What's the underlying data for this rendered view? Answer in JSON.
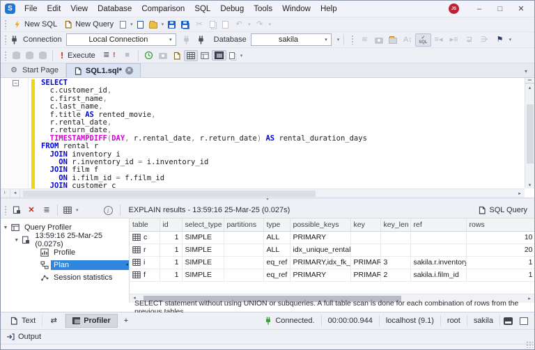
{
  "icons": {
    "caret_down": "▾",
    "caret_up": "▴",
    "arrow_left": "◂",
    "arrow_right": "▸",
    "close": "✕",
    "minimize": "–",
    "maximize": "□",
    "stop": "■",
    "undo": "↶",
    "redo": "↷",
    "history": "◷",
    "scissors": "✂",
    "script": "≣",
    "bang": "!",
    "collapse": "−",
    "plus": "+",
    "swap": "⇄",
    "gear": "⚙",
    "info": "i",
    "split": "⊟",
    "sql_badge": "SQL",
    "case": "A↕",
    "indent_l": "≡◂",
    "indent_r": "▸≡",
    "bookmark": "⚑",
    "delete_x": "✕",
    "grid": "▦"
  },
  "window": {
    "app_initial": "S",
    "menus": [
      "File",
      "Edit",
      "View",
      "Database",
      "Comparison",
      "SQL",
      "Debug",
      "Tools",
      "Window",
      "Help"
    ],
    "avatar": "JS"
  },
  "toolbar_standard": {
    "new_sql": "New SQL",
    "new_query": "New Query"
  },
  "toolbar_connection": {
    "connection_label": "Connection",
    "connection_value": "Local Connection",
    "database_label": "Database",
    "database_value": "sakila"
  },
  "toolbar_execute": {
    "execute_label": "Execute"
  },
  "tabs": {
    "start_page": "Start Page",
    "sql_doc": "SQL1.sql*"
  },
  "editor": {
    "lines": [
      [
        {
          "t": "SELECT",
          "c": "kw"
        }
      ],
      [
        {
          "t": "  c.customer_id",
          "c": "pl"
        },
        {
          "t": ",",
          "c": "gr"
        }
      ],
      [
        {
          "t": "  c.first_name",
          "c": "pl"
        },
        {
          "t": ",",
          "c": "gr"
        }
      ],
      [
        {
          "t": "  c.last_name",
          "c": "pl"
        },
        {
          "t": ",",
          "c": "gr"
        }
      ],
      [
        {
          "t": "  f.title ",
          "c": "pl"
        },
        {
          "t": "AS",
          "c": "kw"
        },
        {
          "t": " rented_movie",
          "c": "pl"
        },
        {
          "t": ",",
          "c": "gr"
        }
      ],
      [
        {
          "t": "  r.rental_date",
          "c": "pl"
        },
        {
          "t": ",",
          "c": "gr"
        }
      ],
      [
        {
          "t": "  r.return_date",
          "c": "pl"
        },
        {
          "t": ",",
          "c": "gr"
        }
      ],
      [
        {
          "t": "  ",
          "c": "pl"
        },
        {
          "t": "TIMESTAMPDIFF",
          "c": "fn"
        },
        {
          "t": "(",
          "c": "gr"
        },
        {
          "t": "DAY",
          "c": "fn"
        },
        {
          "t": ", ",
          "c": "gr"
        },
        {
          "t": "r.rental_date",
          "c": "pl"
        },
        {
          "t": ", ",
          "c": "gr"
        },
        {
          "t": "r.return_date",
          "c": "pl"
        },
        {
          "t": ") ",
          "c": "gr"
        },
        {
          "t": "AS",
          "c": "kw"
        },
        {
          "t": " rental_duration_days",
          "c": "pl"
        }
      ],
      [
        {
          "t": "FROM",
          "c": "kw"
        },
        {
          "t": " rental r",
          "c": "pl"
        }
      ],
      [
        {
          "t": "  ",
          "c": "pl"
        },
        {
          "t": "JOIN",
          "c": "kw"
        },
        {
          "t": " inventory i",
          "c": "pl"
        }
      ],
      [
        {
          "t": "    ",
          "c": "pl"
        },
        {
          "t": "ON",
          "c": "kw"
        },
        {
          "t": " r.inventory_id ",
          "c": "pl"
        },
        {
          "t": "=",
          "c": "gr"
        },
        {
          "t": " i.inventory_id",
          "c": "pl"
        }
      ],
      [
        {
          "t": "  ",
          "c": "pl"
        },
        {
          "t": "JOIN",
          "c": "kw"
        },
        {
          "t": " film f",
          "c": "pl"
        }
      ],
      [
        {
          "t": "    ",
          "c": "pl"
        },
        {
          "t": "ON",
          "c": "kw"
        },
        {
          "t": " i.film_id ",
          "c": "pl"
        },
        {
          "t": "=",
          "c": "gr"
        },
        {
          "t": " f.film_id",
          "c": "pl"
        }
      ],
      [
        {
          "t": "  ",
          "c": "pl"
        },
        {
          "t": "JOIN",
          "c": "kw"
        },
        {
          "t": " customer c",
          "c": "pl"
        }
      ]
    ]
  },
  "results": {
    "title": "EXPLAIN results - 13:59:16 25-Mar-25 (0.027s)",
    "doc_type_label": "SQL Query",
    "tree": {
      "root": "Query Profiler",
      "session": "13:59:16 25-Mar-25 (0.027s)",
      "items": [
        "Profile",
        "Plan",
        "Session statistics"
      ],
      "selected": "Plan"
    },
    "table": {
      "columns": [
        "table",
        "id",
        "select_type",
        "partitions",
        "type",
        "possible_keys",
        "key",
        "key_len",
        "ref",
        "rows"
      ],
      "rows": [
        [
          "c",
          "1",
          "SIMPLE",
          "",
          "ALL",
          "PRIMARY",
          "",
          "",
          "",
          "10"
        ],
        [
          "r",
          "1",
          "SIMPLE",
          "",
          "ALL",
          "idx_unique_rental",
          "",
          "",
          "",
          "20"
        ],
        [
          "i",
          "1",
          "SIMPLE",
          "",
          "eq_ref",
          "PRIMARY,idx_fk_film_id",
          "PRIMARY",
          "3",
          "sakila.r.inventory_id",
          "1"
        ],
        [
          "f",
          "1",
          "SIMPLE",
          "",
          "eq_ref",
          "PRIMARY",
          "PRIMARY",
          "2",
          "sakila.i.film_id",
          "1"
        ]
      ]
    },
    "hint": "SELECT statement without using UNION or subqueries. A full table scan is done for each combination of rows from the previous tables."
  },
  "bottom_tabs": {
    "text": "Text",
    "profiler": "Profiler"
  },
  "status": {
    "connected": "Connected.",
    "time": "00:00:00.944",
    "host": "localhost (9.1)",
    "user": "root",
    "database": "sakila"
  },
  "output": {
    "label": "Output"
  },
  "colors": {
    "accent_blue": "#1e78d7",
    "selection_blue": "#2e86de",
    "execute_red": "#dd2418",
    "keyword_blue": "#0000e0",
    "function_magenta": "#d800d8",
    "change_bar_yellow": "#f2d60c",
    "connected_green": "#3a9e3a",
    "avatar_red": "#c22033"
  }
}
